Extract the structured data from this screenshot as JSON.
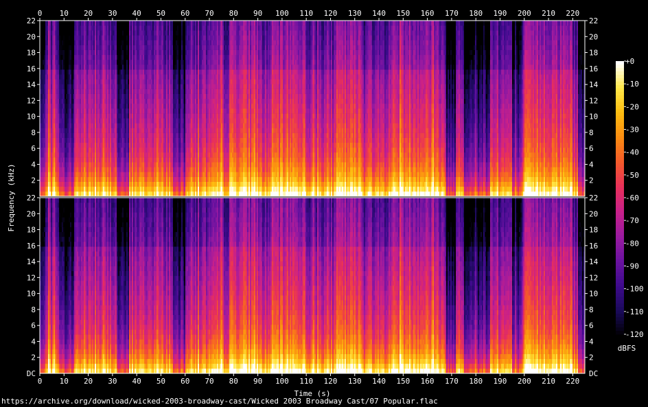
{
  "chart_data": {
    "type": "heatmap",
    "title": "",
    "xlabel": "Time (s)",
    "ylabel": "Frequency (kHz)",
    "xlim": [
      0,
      225
    ],
    "ylim": [
      0,
      22
    ],
    "x_ticks": [
      0,
      10,
      20,
      30,
      40,
      50,
      60,
      70,
      80,
      90,
      100,
      110,
      120,
      130,
      140,
      150,
      160,
      170,
      180,
      190,
      200,
      210,
      220
    ],
    "y_ticks": [
      2,
      4,
      6,
      8,
      10,
      12,
      14,
      16,
      18,
      20,
      22
    ],
    "y_bottom_label": "DC",
    "channels": 2,
    "colorbar": {
      "label": "dBFS",
      "ticks": [
        "+0",
        "-10",
        "-20",
        "-30",
        "-40",
        "-50",
        "-60",
        "-70",
        "-80",
        "-90",
        "-100",
        "-110",
        "-120"
      ],
      "range": [
        -120,
        0
      ],
      "colors": [
        "#000000",
        "#1a0a5a",
        "#3d0a8c",
        "#6a12a0",
        "#9a1aa0",
        "#c8208a",
        "#e8305a",
        "#f55a2a",
        "#fb8c10",
        "#fdbd10",
        "#ffe84a",
        "#ffffff"
      ]
    },
    "energy_profile": {
      "description_free": true,
      "quiet_segments": [
        [
          0,
          2
        ],
        [
          8,
          14
        ],
        [
          32,
          37
        ],
        [
          55,
          60
        ],
        [
          168,
          172
        ],
        [
          175,
          186
        ],
        [
          195,
          199
        ],
        [
          222,
          225
        ]
      ],
      "loud_segments": [
        [
          78,
          90
        ],
        [
          95,
          110
        ],
        [
          122,
          133
        ],
        [
          145,
          165
        ],
        [
          200,
          220
        ]
      ]
    }
  },
  "source_text": "https://archive.org/download/wicked-2003-broadway-cast/Wicked 2003 Broadway Cast/07 Popular.flac"
}
